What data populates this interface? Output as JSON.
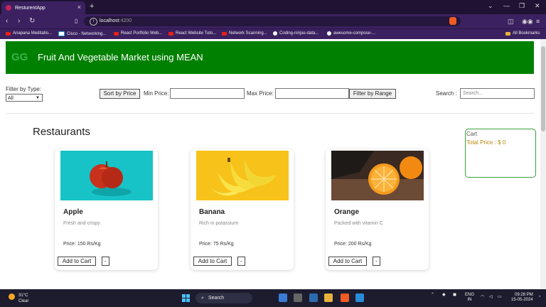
{
  "browser": {
    "tab_title": "ResturentApp",
    "url_host": "localhost",
    "url_port": ":4200",
    "bookmarks": [
      "Anapana Meditatio...",
      "Cisco - Networking...",
      "React Portfolio Web...",
      "React Website Tuto...",
      "Network Scanning...",
      "Coding-ninjas-data...",
      "awesome-compose-..."
    ],
    "all_bookmarks": "All Bookmarks"
  },
  "header": {
    "title": "Fruit And Vegetable Market using MEAN"
  },
  "filters": {
    "filter_type_label": "Filter by Type:",
    "filter_type_value": "All",
    "sort_by_price": "Sort by Price",
    "min_price_label": "Min Price:",
    "max_price_label": "Max Price:",
    "filter_by_range": "Filter by Range",
    "search_label": "Search :",
    "search_placeholder": "Search..."
  },
  "section_title": "Restaurants",
  "products": [
    {
      "name": "Apple",
      "description": "Fresh and crispy",
      "price": "Price: 150 Rs/Kg",
      "add_label": "Add to Cart",
      "remove_label": "-"
    },
    {
      "name": "Banana",
      "description": "Rich in potassium",
      "price": "Price: 75 Rs/Kg",
      "add_label": "Add to Cart",
      "remove_label": "-"
    },
    {
      "name": "Orange",
      "description": "Packed with vitamin C",
      "price": "Price: 200 Rs/Kg",
      "add_label": "Add to Cart",
      "remove_label": "-"
    }
  ],
  "cart": {
    "title": "Cart",
    "total": "Total Price : $ 0"
  },
  "taskbar": {
    "temperature": "31°C",
    "weather": "Clear",
    "search": "Search",
    "lang_top": "ENG",
    "lang_bottom": "IN",
    "time": "09:28 PM",
    "date": "15-05-2024"
  },
  "colors": {
    "banner": "#008000",
    "cart_border": "#3a9f3a",
    "cart_total": "#b8860b"
  }
}
